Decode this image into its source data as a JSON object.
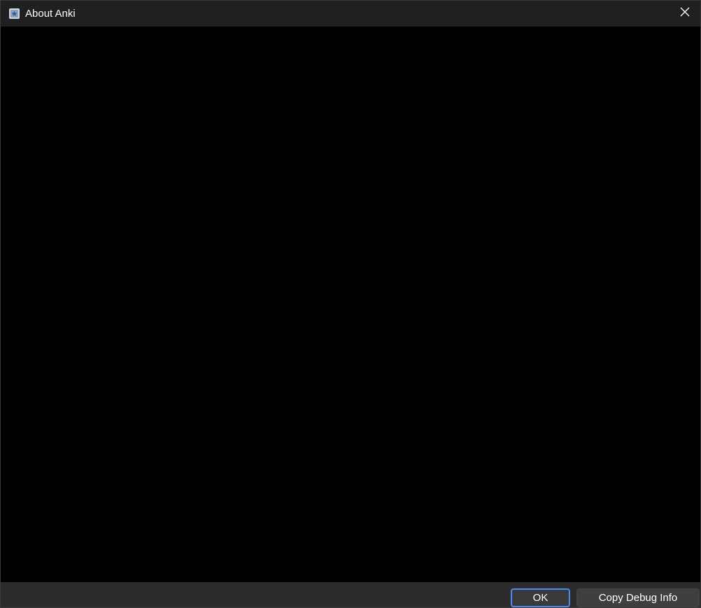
{
  "window": {
    "title": "About Anki",
    "app_icon": "anki-star-icon",
    "close_icon": "close-icon"
  },
  "footer": {
    "ok_label": "OK",
    "copy_debug_label": "Copy Debug Info"
  },
  "colors": {
    "accent": "#4a8af4",
    "titlebar": "#202020",
    "content": "#000000",
    "footer": "#2c2c2c"
  }
}
